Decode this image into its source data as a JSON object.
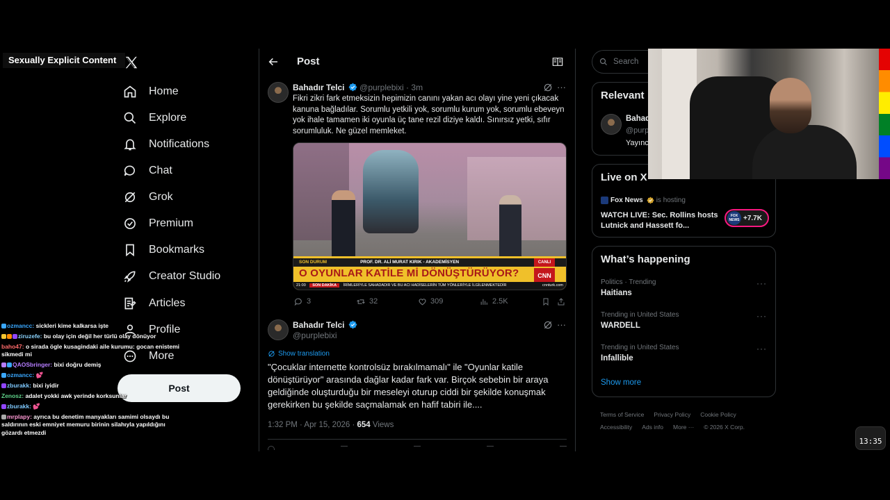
{
  "warning_label": "Sexually Explicit Content",
  "nav": {
    "items": [
      {
        "label": "Home",
        "icon": "home-icon"
      },
      {
        "label": "Explore",
        "icon": "search-icon"
      },
      {
        "label": "Notifications",
        "icon": "bell-icon"
      },
      {
        "label": "Chat",
        "icon": "chat-icon"
      },
      {
        "label": "Grok",
        "icon": "grok-icon"
      },
      {
        "label": "Premium",
        "icon": "premium-icon"
      },
      {
        "label": "Bookmarks",
        "icon": "bookmark-icon"
      },
      {
        "label": "Creator Studio",
        "icon": "rocket-icon"
      },
      {
        "label": "Articles",
        "icon": "article-icon"
      },
      {
        "label": "Profile",
        "icon": "person-icon"
      },
      {
        "label": "More",
        "icon": "more-icon"
      }
    ],
    "post_button": "Post"
  },
  "chat": [
    {
      "user": "ozmancc:",
      "text": "sickleri kime kalkarsa işte",
      "color": "#3aa8ff"
    },
    {
      "user": "ziruzefe:",
      "text": "bu olay için değil her türlü olay dönüyor",
      "color": "#8bd3ff"
    },
    {
      "user": "baho47:",
      "text": "o sirada ögle kusagindaki aile kurumu: gocan enistemi sikmedi mi",
      "color": "#ff6b6b"
    },
    {
      "user": "QAOSbringer:",
      "text": "bixi doğru demiş",
      "color": "#b67dff"
    },
    {
      "user": "ozmancc:",
      "text": "💕",
      "color": "#3aa8ff"
    },
    {
      "user": "zburakk:",
      "text": "bixi iyidir",
      "color": "#7ec8ff"
    },
    {
      "user": "Zenosz:",
      "text": "adalet yokki awk yerinde korksunlar",
      "color": "#5fd38a"
    },
    {
      "user": "zburakk:",
      "text": "💕",
      "color": "#7ec8ff"
    },
    {
      "user": "mrplapy:",
      "text": "ayrıca bu denetim manyakları samimi olsaydı bu saldırının eski emniyet memuru birinin silahıyla yapıldığını gözardı etmezdi",
      "color": "#ff9ad5"
    }
  ],
  "header": {
    "title": "Post"
  },
  "quote_tweet": {
    "name": "Bahadır Telci",
    "handle": "@purplebixi",
    "time": "3m",
    "text": "Fikri zikri fark etmeksizin hepimizin canını yakan acı olayı yine yeni çıkacak kanuna bağladılar. Sorumlu yetkili yok, sorumlu kurum yok, sorumlu ebeveyn yok ihale tamamen iki oyunla üç tane rezil diziye kaldı. Sınırsız yetki, sıfır sorumluluk. Ne güzel memleket.",
    "media": {
      "strap": "SON DURUM",
      "guest": "PROF. DR. ALİ MURAT KIRIK - AKADEMİSYEN",
      "live": "CANLI",
      "headline": "O OYUNLAR KATİLE Mİ DÖNÜŞTÜRÜYOR?",
      "brand": "CNN TÜRK",
      "ticker_time": "21:00",
      "ticker_label": "SON DAKİKA",
      "ticker_text": "İRİMLERİYLE SAHADADIR VE BU ACI HADİSELERİN TÜM YÖNLERİYLE İLGİLENMEKTEDİR",
      "site": "cnnturk.com"
    },
    "stats": {
      "replies": "3",
      "reposts": "32",
      "likes": "309",
      "views": "2.5K"
    }
  },
  "original_tweet": {
    "name": "Bahadır Telci",
    "handle": "@purplebixi",
    "show_translation": "Show translation",
    "text": "\"Çocuklar internette kontrolsüz bırakılmamalı\" ile \"Oyunlar katile dönüştürüyor\" arasında dağlar kadar fark var. Birçok sebebin bir araya geldiğinde oluşturduğu bir meseleyi oturup ciddi bir şekilde konuşmak gerekirken bu şekilde saçmalamak en hafif tabiri ile....",
    "timestamp": "1:32 PM · Apr 15, 2026 · ",
    "views_count": "654",
    "views_label": " Views"
  },
  "right": {
    "search_placeholder": "Search",
    "relevant": {
      "title": "Relevant",
      "name": "Bahad",
      "handle": "@purp",
      "bio": "Yayıncı"
    },
    "live": {
      "title": "Live on X",
      "host": "Fox News",
      "host_suffix": "is hosting",
      "headline": "WATCH LIVE: Sec. Rollins hosts Lutnick and Hassett fo...",
      "viewers": "+7.7K",
      "logo_top": "FOX",
      "logo_bottom": "NEWS"
    },
    "happening": {
      "title": "What’s happening",
      "trends": [
        {
          "category": "Politics · Trending",
          "name": "Haitians"
        },
        {
          "category": "Trending in United States",
          "name": "WARDELL"
        },
        {
          "category": "Trending in United States",
          "name": "Infallible"
        }
      ],
      "show_more": "Show more"
    },
    "footer": [
      "Terms of Service",
      "Privacy Policy",
      "Cookie Policy",
      "Accessibility",
      "Ads info",
      "More ···",
      "© 2026 X Corp."
    ]
  },
  "clock": "13:35"
}
